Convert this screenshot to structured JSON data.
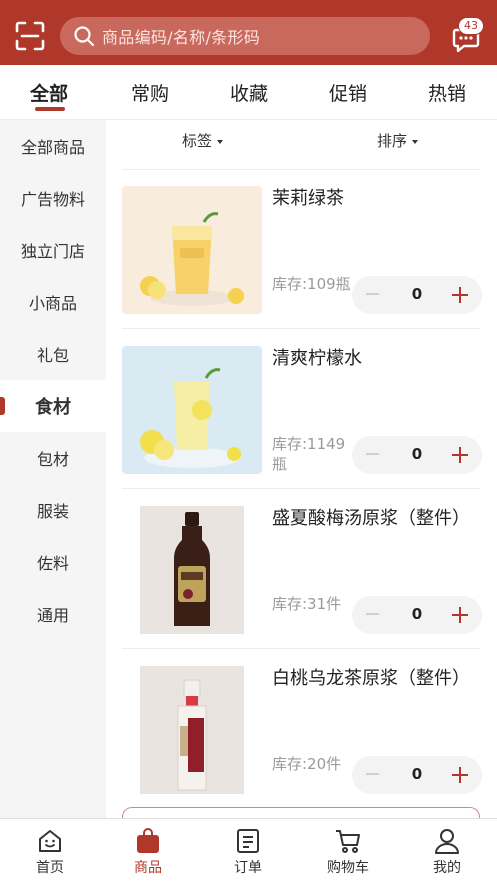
{
  "header": {
    "search_placeholder": "商品编码/名称/条形码",
    "message_badge": "43"
  },
  "tabs": [
    {
      "label": "全部",
      "active": true
    },
    {
      "label": "常购"
    },
    {
      "label": "收藏"
    },
    {
      "label": "促销"
    },
    {
      "label": "热销"
    }
  ],
  "sidebar": {
    "items": [
      {
        "label": "全部商品"
      },
      {
        "label": "广告物料"
      },
      {
        "label": "独立门店"
      },
      {
        "label": "小商品"
      },
      {
        "label": "礼包"
      },
      {
        "label": "食材",
        "active": true
      },
      {
        "label": "包材"
      },
      {
        "label": "服装"
      },
      {
        "label": "佐料"
      },
      {
        "label": "通用"
      }
    ]
  },
  "filters": {
    "tag_label": "标签",
    "sort_label": "排序"
  },
  "products": [
    {
      "name": "茉莉绿茶",
      "stock": "库存:109瓶",
      "qty": "0"
    },
    {
      "name": "清爽柠檬水",
      "stock": "库存:1149瓶",
      "qty": "0"
    },
    {
      "name": "盛夏酸梅汤原浆（整件）",
      "stock": "库存:31件",
      "qty": "0"
    },
    {
      "name": "白桃乌龙茶原浆（整件）",
      "stock": "库存:20件",
      "qty": "0"
    }
  ],
  "bottom_nav": [
    {
      "label": "首页",
      "icon": "home-icon"
    },
    {
      "label": "商品",
      "icon": "bag-icon",
      "active": true
    },
    {
      "label": "订单",
      "icon": "order-icon"
    },
    {
      "label": "购物车",
      "icon": "cart-icon"
    },
    {
      "label": "我的",
      "icon": "user-icon"
    }
  ],
  "colors": {
    "brand": "#b0382a",
    "sidebar_bg": "#f5f5f5"
  }
}
